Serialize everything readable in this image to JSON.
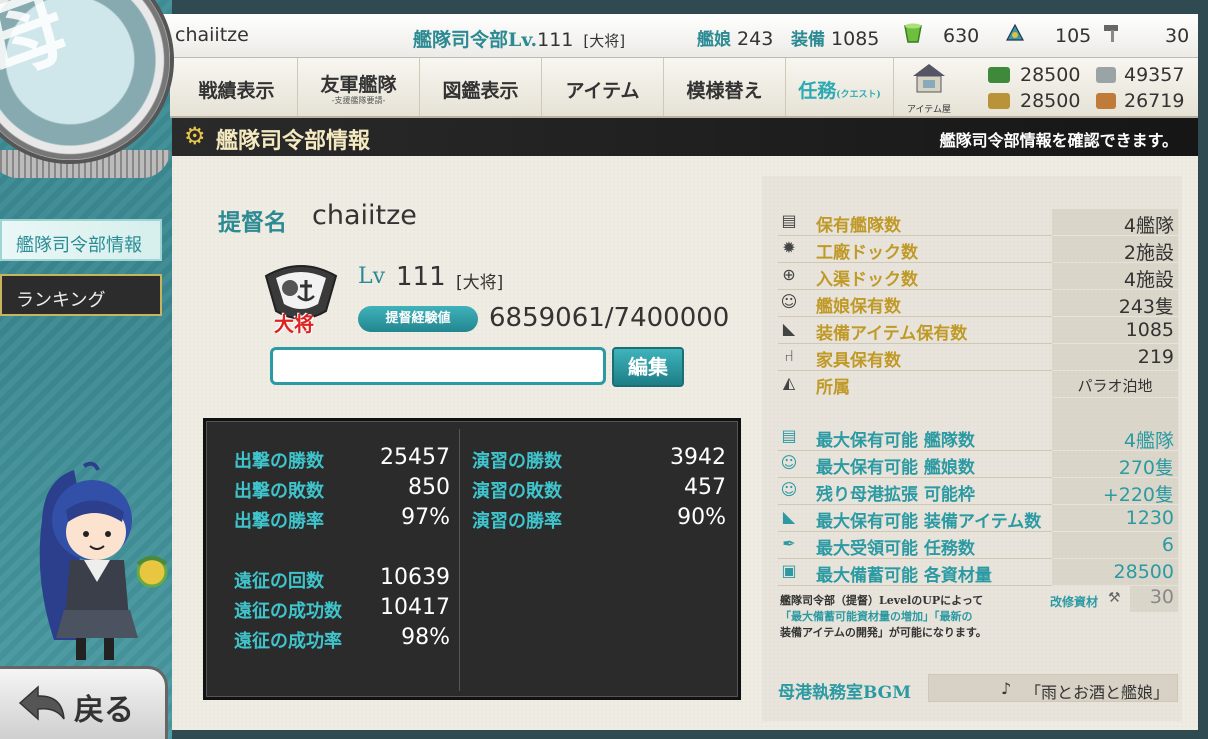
{
  "player": {
    "name": "chaiitze"
  },
  "top_bar": {
    "hq_level_label": "艦隊司令部Lv.",
    "hq_level": "111",
    "rank": "[大将]",
    "ship_label": "艦娘",
    "ship_count": "243",
    "equip_label": "装備",
    "equip_count": "1085",
    "bucket": "630",
    "dev_material": "105",
    "improve_material": "30"
  },
  "nav": {
    "items": [
      {
        "label": "戦績表示",
        "sub": ""
      },
      {
        "label": "友軍艦隊",
        "sub": "-支援艦隊要請-"
      },
      {
        "label": "図鑑表示",
        "sub": ""
      },
      {
        "label": "アイテム",
        "sub": ""
      },
      {
        "label": "模様替え",
        "sub": ""
      },
      {
        "label": "任務",
        "sub": "(クエスト)"
      }
    ],
    "item_shop_label": "アイテム屋"
  },
  "resources": {
    "fuel": "28500",
    "ammo": "28500",
    "steel": "49357",
    "bauxite": "26719"
  },
  "header": {
    "title": "艦隊司令部情報",
    "description": "艦隊司令部情報を確認できます。"
  },
  "side_menu": {
    "hq_info": "艦隊司令部情報",
    "ranking": "ランキング"
  },
  "profile": {
    "admiral_label": "提督名",
    "admiral_name": "chaiitze",
    "level_label": "Lv",
    "level": "111",
    "rank": "[大将]",
    "rank_badge": "大将",
    "exp_label": "提督経験値",
    "exp_value": "6859061/7400000",
    "comment_value": "",
    "edit_button": "編集"
  },
  "battle_stats": {
    "left": [
      {
        "label": "出撃の勝数",
        "value": "25457"
      },
      {
        "label": "出撃の敗数",
        "value": "850"
      },
      {
        "label": "出撃の勝率",
        "value": "97%"
      },
      {
        "label": "遠征の回数",
        "value": "10639"
      },
      {
        "label": "遠征の成功数",
        "value": "10417"
      },
      {
        "label": "遠征の成功率",
        "value": "98%"
      }
    ],
    "right": [
      {
        "label": "演習の勝数",
        "value": "3942"
      },
      {
        "label": "演習の敗数",
        "value": "457"
      },
      {
        "label": "演習の勝率",
        "value": "90%"
      }
    ]
  },
  "info": {
    "rows": [
      {
        "label": "保有艦隊数",
        "value": "4艦隊"
      },
      {
        "label": "工廠ドック数",
        "value": "2施設"
      },
      {
        "label": "入渠ドック数",
        "value": "4施設"
      },
      {
        "label": "艦娘保有数",
        "value": "243隻"
      },
      {
        "label": "装備アイテム保有数",
        "value": "1085"
      },
      {
        "label": "家具保有数",
        "value": "219"
      },
      {
        "label": "所属",
        "value": "パラオ泊地"
      }
    ],
    "max_rows": [
      {
        "label": "最大保有可能 艦隊数",
        "value": "4艦隊"
      },
      {
        "label": "最大保有可能 艦娘数",
        "value": "270隻"
      },
      {
        "label": "残り母港拡張 可能枠",
        "value": "+220隻"
      },
      {
        "label": "最大保有可能 装備アイテム数",
        "value": "1230"
      },
      {
        "label": "最大受領可能 任務数",
        "value": "6"
      },
      {
        "label": "最大備蓄可能 各資材量",
        "value": "28500"
      }
    ],
    "upgrade_note_1": "艦隊司令部（提督）LevelのUPによって",
    "upgrade_note_2": "「最大備蓄可能資材量の増加」「最新の",
    "upgrade_note_3": "装備アイテムの開発」が可能になります。",
    "kaishu_label": "改修資材",
    "kaishu_value": "30"
  },
  "bgm": {
    "label": "母港執務室BGM",
    "value": "「雨とお酒と艦娘」"
  },
  "back_button": {
    "label": "戻る"
  },
  "colors": {
    "accent_teal": "#2c9aa3",
    "gold_label": "#c09a28",
    "header_bg": "#1f1f1f"
  }
}
